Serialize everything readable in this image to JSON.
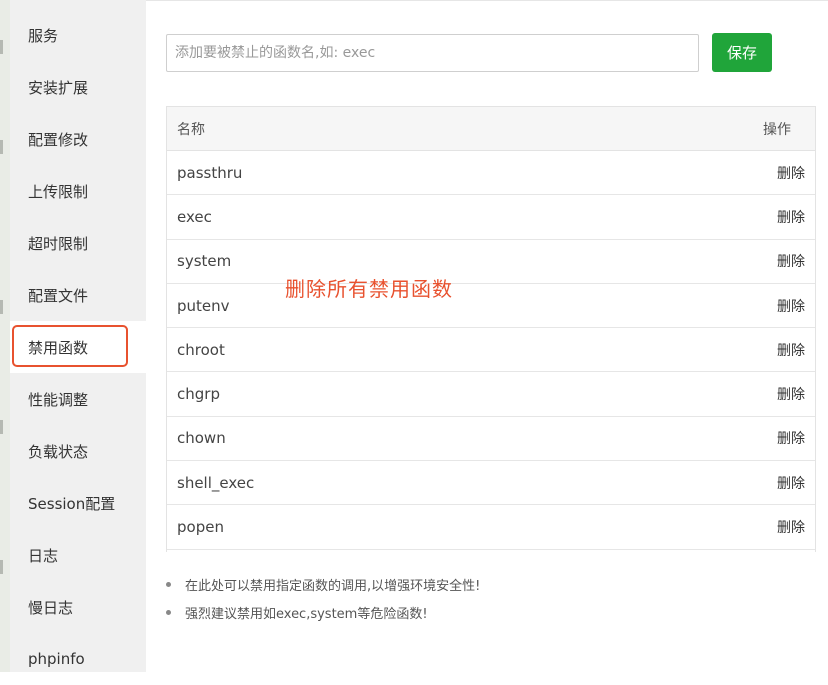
{
  "sidebar": {
    "items": [
      {
        "label": "服务"
      },
      {
        "label": "安装扩展"
      },
      {
        "label": "配置修改"
      },
      {
        "label": "上传限制"
      },
      {
        "label": "超时限制"
      },
      {
        "label": "配置文件"
      },
      {
        "label": "禁用函数"
      },
      {
        "label": "性能调整"
      },
      {
        "label": "负载状态"
      },
      {
        "label": "Session配置"
      },
      {
        "label": "日志"
      },
      {
        "label": "慢日志"
      },
      {
        "label": "phpinfo"
      }
    ],
    "active_item": "禁用函数"
  },
  "form": {
    "placeholder": "添加要被禁止的函数名,如: exec",
    "value": "",
    "save_label": "保存"
  },
  "table": {
    "headers": {
      "name": "名称",
      "action": "操作"
    },
    "rows": [
      {
        "name": "passthru",
        "action": "删除"
      },
      {
        "name": "exec",
        "action": "删除"
      },
      {
        "name": "system",
        "action": "删除"
      },
      {
        "name": "putenv",
        "action": "删除"
      },
      {
        "name": "chroot",
        "action": "删除"
      },
      {
        "name": "chgrp",
        "action": "删除"
      },
      {
        "name": "chown",
        "action": "删除"
      },
      {
        "name": "shell_exec",
        "action": "删除"
      },
      {
        "name": "popen",
        "action": "删除"
      }
    ]
  },
  "annotation": {
    "text": "删除所有禁用函数",
    "color": "#e8522f"
  },
  "tips": [
    "在此处可以禁用指定函数的调用,以增强环境安全性!",
    "强烈建议禁用如exec,system等危险函数!"
  ],
  "colors": {
    "accent": "#20a53a",
    "highlight": "#e8522f"
  }
}
